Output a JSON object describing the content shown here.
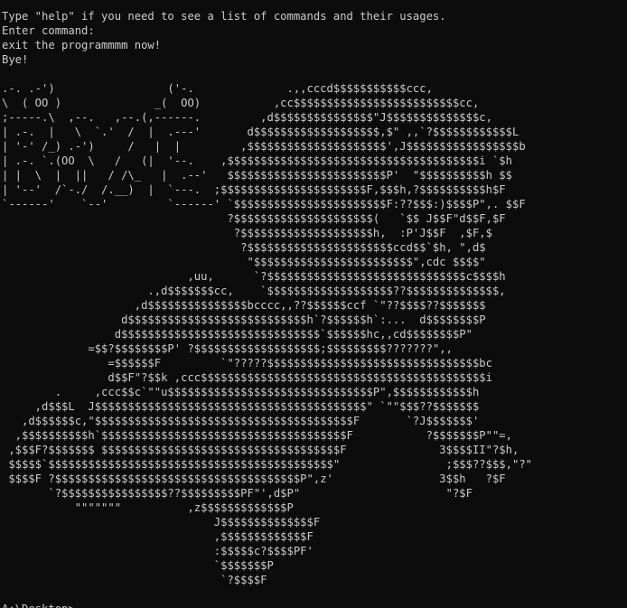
{
  "window": {
    "colors": {
      "background": "#0c0c0c",
      "foreground": "#cccccc"
    }
  },
  "console": {
    "lines": [
      "Type \"help\" if you need to see a list of commands and their usages.",
      "Enter command:",
      "exit the programmmm now!",
      "Bye!",
      "",
      ".-. .-')                 ('-.              .,,cccd$$$$$$$$$$$ccc,",
      "\\  ( OO )              _(  OO)           ,cc$$$$$$$$$$$$$$$$$$$$$$$$$cc,",
      ";-----.\\  ,--.   ,--.(,------.         ,d$$$$$$$$$$$$$$$\"J$$$$$$$$$$$$$$c,",
      "| .-.  |   \\  `.'  /  |  .---'       d$$$$$$$$$$$$$$$$$$$,$\" ,,`?$$$$$$$$$$$$L",
      "| '-' /_) .-')     /   |  |         ,$$$$$$$$$$$$$$$$$$$$$',J$$$$$$$$$$$$$$$$$b",
      "| .-. `.(OO  \\   /   (|  '--.    ,$$$$$$$$$$$$$$$$$$$$$$$$$$$$$$$$$$$$$$i `$h",
      "| |  \\  |  ||   / /\\_   |  .--'   $$$$$$$$$$$$$$$$$$$$$$$$P'  \"$$$$$$$$$$h $$",
      "| '--'  /`-./  /.__)  |  `---.  ;$$$$$$$$$$$$$$$$$$$$$$F,$$$h,?$$$$$$$$$$h$F",
      "`------'    `--'         `------' `$$$$$$$$$$$$$$$$$$$$$$$F:??$$$:)$$$$P\",. $$F",
      "                                  ?$$$$$$$$$$$$$$$$$$$$$(   `$$ J$$F\"d$$F,$F",
      "                                   ?$$$$$$$$$$$$$$$$$$$$h,  :P'J$$F  ,$F,$",
      "                                    ?$$$$$$$$$$$$$$$$$$$$$$ccd$$`$h, \",d$",
      "                                     \"$$$$$$$$$$$$$$$$$$$$$$$$\",cdc $$$$\"",
      "                            ,uu,      `?$$$$$$$$$$$$$$$$$$$$$$$$$$$$$$c$$$$h",
      "                      .,d$$$$$$$cc,    `$$$$$$$$$$$$$$$$$$$??$$$$$$$$$$$$$$,",
      "                    ,d$$$$$$$$$$$$$$$bcccc,,??$$$$$$ccf `\"??$$$$??$$$$$$$",
      "                  d$$$$$$$$$$$$$$$$$$$$$$$$$$$h`?$$$$$$h`:...  d$$$$$$$$P",
      "                 d$$$$$$$$$$$$$$$$$$$$$$$$$$$$$$`$$$$$$hc,,cd$$$$$$$$P\"",
      "             =$$?$$$$$$$$P' ?$$$$$$$$$$$$$$$$$$$;$$$$$$$$$???????\",,",
      "                =$$$$$$F         `\"?????$$$$$$$$$$$$$$$$$$$$$$$$$$$$$$$$bc",
      "                d$$F\"?$$k ,ccc$$$$$$$$$$$$$$$$$$$$$$$$$$$$$$$$$$$$$$$$$$$i",
      "        .     ,ccc$$c`\"\"u$$$$$$$$$$$$$$$$$$$$$$$$$$$$$$$P\",$$$$$$$$$$$$h",
      "     ,d$$$L  J$$$$$$$$$$$$$$$$$$$$$$$$$$$$$$$$$$$$$$$$$\" `\"\"$$$??$$$$$$$",
      "   ,d$$$$$$c,\"$$$$$$$$$$$$$$$$$$$$$$$$$$$$$$$$$$$$$$$F       `?J$$$$$$$'",
      "  ,$$$$$$$$$$h`$$$$$$$$$$$$$$$$$$$$$$$$$$$$$$$$$$$$$F           ?$$$$$$$P\"\"=,",
      " ,$$$F?$$$$$$$ $$$$$$$$$$$$$$$$$$$$$$$$$$$$$$$$$$$$F              3$$$$II\"?$h,",
      " $$$$$`$$$$$$$$$$$$$$$$$$$$$$$$$$$$$$$$$$$$$$$$$$$\"                ;$$$??$$$,\"?\"",
      " $$$$F ?$$$$$$$$$$$$$$$$$$$$$$$$$$$$$$$$$$$$$P\",z'                3$$h   ?$F",
      "       `?$$$$$$$$$$$$$$$$??$$$$$$$$$PF\"',d$P\"                      \"?$F",
      "           \"\"\"\"\"\"\"          ,z$$$$$$$$$$$$$P",
      "                                J$$$$$$$$$$$$$$F",
      "                                ,$$$$$$$$$$$$$F",
      "                                :$$$$$c?$$$$PF'",
      "                                `$$$$$$$P",
      "                                 `?$$$$F",
      "",
      "A:\\Desktop>"
    ]
  }
}
